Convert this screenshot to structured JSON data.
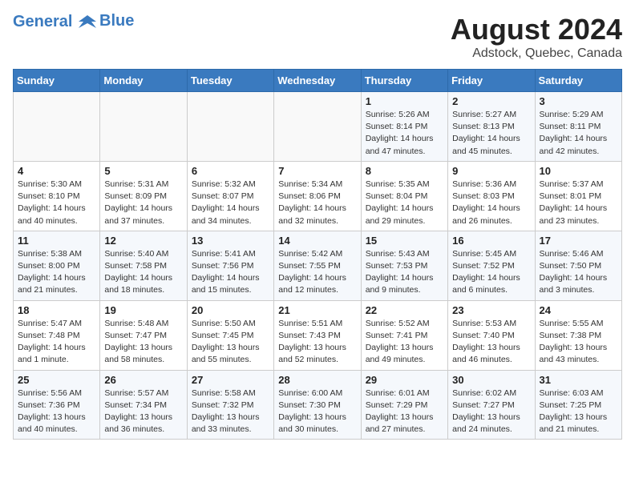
{
  "header": {
    "logo_line1": "General",
    "logo_line2": "Blue",
    "month": "August 2024",
    "location": "Adstock, Quebec, Canada"
  },
  "weekdays": [
    "Sunday",
    "Monday",
    "Tuesday",
    "Wednesday",
    "Thursday",
    "Friday",
    "Saturday"
  ],
  "weeks": [
    [
      {
        "day": "",
        "info": ""
      },
      {
        "day": "",
        "info": ""
      },
      {
        "day": "",
        "info": ""
      },
      {
        "day": "",
        "info": ""
      },
      {
        "day": "1",
        "info": "Sunrise: 5:26 AM\nSunset: 8:14 PM\nDaylight: 14 hours\nand 47 minutes."
      },
      {
        "day": "2",
        "info": "Sunrise: 5:27 AM\nSunset: 8:13 PM\nDaylight: 14 hours\nand 45 minutes."
      },
      {
        "day": "3",
        "info": "Sunrise: 5:29 AM\nSunset: 8:11 PM\nDaylight: 14 hours\nand 42 minutes."
      }
    ],
    [
      {
        "day": "4",
        "info": "Sunrise: 5:30 AM\nSunset: 8:10 PM\nDaylight: 14 hours\nand 40 minutes."
      },
      {
        "day": "5",
        "info": "Sunrise: 5:31 AM\nSunset: 8:09 PM\nDaylight: 14 hours\nand 37 minutes."
      },
      {
        "day": "6",
        "info": "Sunrise: 5:32 AM\nSunset: 8:07 PM\nDaylight: 14 hours\nand 34 minutes."
      },
      {
        "day": "7",
        "info": "Sunrise: 5:34 AM\nSunset: 8:06 PM\nDaylight: 14 hours\nand 32 minutes."
      },
      {
        "day": "8",
        "info": "Sunrise: 5:35 AM\nSunset: 8:04 PM\nDaylight: 14 hours\nand 29 minutes."
      },
      {
        "day": "9",
        "info": "Sunrise: 5:36 AM\nSunset: 8:03 PM\nDaylight: 14 hours\nand 26 minutes."
      },
      {
        "day": "10",
        "info": "Sunrise: 5:37 AM\nSunset: 8:01 PM\nDaylight: 14 hours\nand 23 minutes."
      }
    ],
    [
      {
        "day": "11",
        "info": "Sunrise: 5:38 AM\nSunset: 8:00 PM\nDaylight: 14 hours\nand 21 minutes."
      },
      {
        "day": "12",
        "info": "Sunrise: 5:40 AM\nSunset: 7:58 PM\nDaylight: 14 hours\nand 18 minutes."
      },
      {
        "day": "13",
        "info": "Sunrise: 5:41 AM\nSunset: 7:56 PM\nDaylight: 14 hours\nand 15 minutes."
      },
      {
        "day": "14",
        "info": "Sunrise: 5:42 AM\nSunset: 7:55 PM\nDaylight: 14 hours\nand 12 minutes."
      },
      {
        "day": "15",
        "info": "Sunrise: 5:43 AM\nSunset: 7:53 PM\nDaylight: 14 hours\nand 9 minutes."
      },
      {
        "day": "16",
        "info": "Sunrise: 5:45 AM\nSunset: 7:52 PM\nDaylight: 14 hours\nand 6 minutes."
      },
      {
        "day": "17",
        "info": "Sunrise: 5:46 AM\nSunset: 7:50 PM\nDaylight: 14 hours\nand 3 minutes."
      }
    ],
    [
      {
        "day": "18",
        "info": "Sunrise: 5:47 AM\nSunset: 7:48 PM\nDaylight: 14 hours\nand 1 minute."
      },
      {
        "day": "19",
        "info": "Sunrise: 5:48 AM\nSunset: 7:47 PM\nDaylight: 13 hours\nand 58 minutes."
      },
      {
        "day": "20",
        "info": "Sunrise: 5:50 AM\nSunset: 7:45 PM\nDaylight: 13 hours\nand 55 minutes."
      },
      {
        "day": "21",
        "info": "Sunrise: 5:51 AM\nSunset: 7:43 PM\nDaylight: 13 hours\nand 52 minutes."
      },
      {
        "day": "22",
        "info": "Sunrise: 5:52 AM\nSunset: 7:41 PM\nDaylight: 13 hours\nand 49 minutes."
      },
      {
        "day": "23",
        "info": "Sunrise: 5:53 AM\nSunset: 7:40 PM\nDaylight: 13 hours\nand 46 minutes."
      },
      {
        "day": "24",
        "info": "Sunrise: 5:55 AM\nSunset: 7:38 PM\nDaylight: 13 hours\nand 43 minutes."
      }
    ],
    [
      {
        "day": "25",
        "info": "Sunrise: 5:56 AM\nSunset: 7:36 PM\nDaylight: 13 hours\nand 40 minutes."
      },
      {
        "day": "26",
        "info": "Sunrise: 5:57 AM\nSunset: 7:34 PM\nDaylight: 13 hours\nand 36 minutes."
      },
      {
        "day": "27",
        "info": "Sunrise: 5:58 AM\nSunset: 7:32 PM\nDaylight: 13 hours\nand 33 minutes."
      },
      {
        "day": "28",
        "info": "Sunrise: 6:00 AM\nSunset: 7:30 PM\nDaylight: 13 hours\nand 30 minutes."
      },
      {
        "day": "29",
        "info": "Sunrise: 6:01 AM\nSunset: 7:29 PM\nDaylight: 13 hours\nand 27 minutes."
      },
      {
        "day": "30",
        "info": "Sunrise: 6:02 AM\nSunset: 7:27 PM\nDaylight: 13 hours\nand 24 minutes."
      },
      {
        "day": "31",
        "info": "Sunrise: 6:03 AM\nSunset: 7:25 PM\nDaylight: 13 hours\nand 21 minutes."
      }
    ]
  ]
}
